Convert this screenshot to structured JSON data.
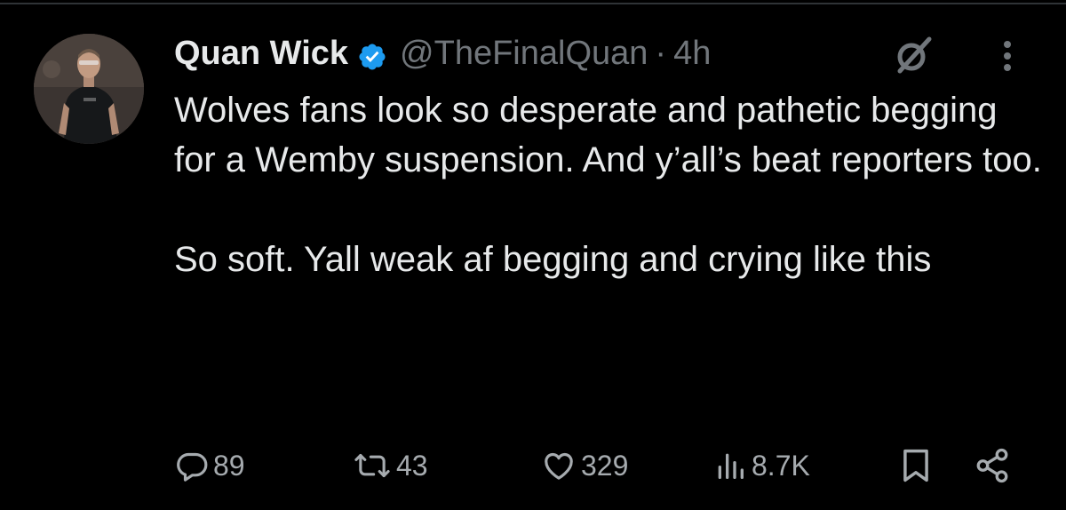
{
  "author": {
    "display_name": "Quan Wick",
    "handle": "@TheFinalQuan",
    "separator": "·",
    "time": "4h",
    "verified_color": "#1d9bf0"
  },
  "tweet": {
    "paragraphs": [
      "Wolves fans look so desperate and pathetic begging for a Wemby suspension. And y’all’s beat reporters too.",
      "So soft. Yall weak af begging and crying like this"
    ]
  },
  "actions": {
    "replies": "89",
    "reposts": "43",
    "likes": "329",
    "views": "8.7K"
  },
  "colors": {
    "background": "#000000",
    "text": "#e7e9ea",
    "muted": "#71767b",
    "action": "#a6abaf",
    "divider": "#2f3336"
  },
  "icons": [
    "grok-icon",
    "more-icon",
    "reply-icon",
    "repost-icon",
    "like-icon",
    "views-icon",
    "bookmark-icon",
    "share-icon",
    "verified-badge-icon"
  ]
}
